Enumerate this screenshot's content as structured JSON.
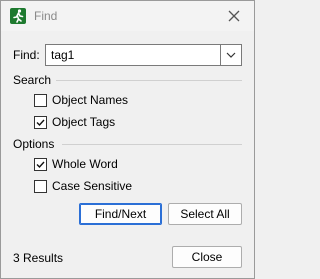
{
  "window": {
    "title": "Find",
    "app_icon": "running-man-icon",
    "close_icon": "close-icon"
  },
  "find": {
    "label": "Find:",
    "value": "tag1",
    "dropdown_icon": "chevron-down-icon"
  },
  "search": {
    "heading": "Search",
    "options": [
      {
        "label": "Object Names",
        "checked": false
      },
      {
        "label": "Object Tags",
        "checked": true
      }
    ]
  },
  "options": {
    "heading": "Options",
    "options": [
      {
        "label": "Whole Word",
        "checked": true
      },
      {
        "label": "Case Sensitive",
        "checked": false
      }
    ]
  },
  "buttons": {
    "find_next": "Find/Next",
    "select_all": "Select All",
    "close": "Close"
  },
  "status": {
    "results": "3 Results"
  },
  "colors": {
    "default_button_border": "#2b6fd6",
    "app_icon_bg": "#1e7a2f"
  }
}
